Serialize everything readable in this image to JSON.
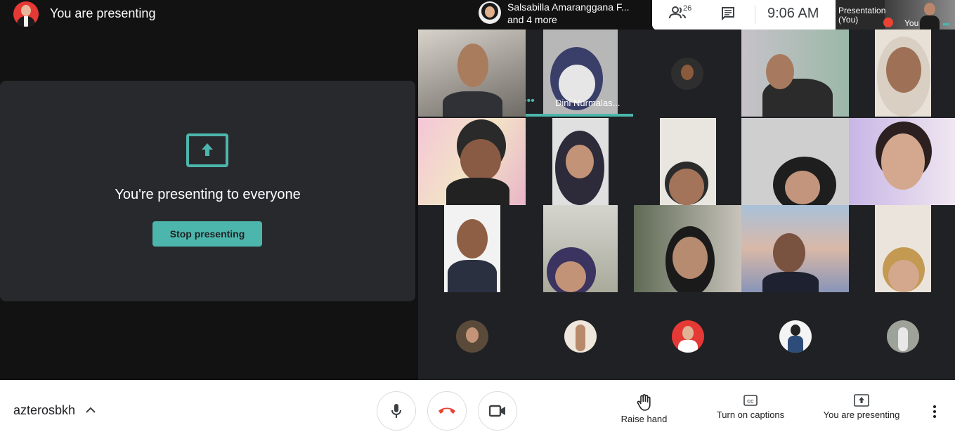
{
  "header": {
    "presenting_title": "You are presenting"
  },
  "present_panel": {
    "message": "You're presenting to everyone",
    "stop_button": "Stop presenting"
  },
  "speaker": {
    "name": "Salsabilla Amaranggana F...",
    "more": "and 4 more"
  },
  "top_bar": {
    "people_count": "26",
    "clock": "9:06 AM"
  },
  "self_tile": {
    "label_line1": "Presentation",
    "label_line2": "(You)",
    "you": "You"
  },
  "grid": {
    "active_speaker_name": "Dini Nurmalas..."
  },
  "bottom": {
    "meeting_code": "azterosbkh",
    "raise_hand": "Raise hand",
    "captions": "Turn on captions",
    "presenting": "You are presenting"
  },
  "colors": {
    "accent": "#4db6ac",
    "end_call": "#ea4335",
    "background": "#202124"
  }
}
